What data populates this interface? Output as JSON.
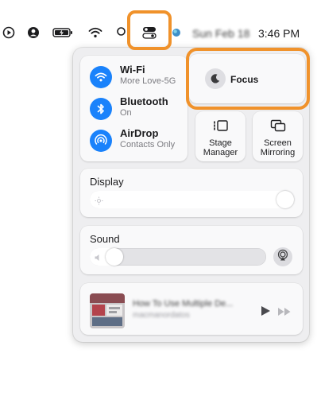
{
  "menubar": {
    "datetime_date": "Sun Feb 18",
    "datetime_time": "3:46 PM",
    "icons": [
      "play-circle-icon",
      "user-circle-icon",
      "battery-charging-icon",
      "wifi-icon",
      "search-icon",
      "control-center-icon",
      "siri-icon"
    ]
  },
  "network": {
    "wifi": {
      "title": "Wi-Fi",
      "subtitle": "More Love-5G"
    },
    "bluetooth": {
      "title": "Bluetooth",
      "subtitle": "On"
    },
    "airdrop": {
      "title": "AirDrop",
      "subtitle": "Contacts Only"
    }
  },
  "focus": {
    "label": "Focus"
  },
  "stage_manager": {
    "label_line1": "Stage",
    "label_line2": "Manager"
  },
  "screen_mirroring": {
    "label_line1": "Screen",
    "label_line2": "Mirroring"
  },
  "display": {
    "title": "Display",
    "brightness": 1.0
  },
  "sound": {
    "title": "Sound",
    "volume": 0.1
  },
  "now_playing": {
    "title": "How To Use Multiple De...",
    "subtitle": "macmanordatos"
  },
  "colors": {
    "accent_blue": "#1a82fb",
    "highlight_orange": "#f0922b",
    "panel_bg": "#eeeef0"
  }
}
